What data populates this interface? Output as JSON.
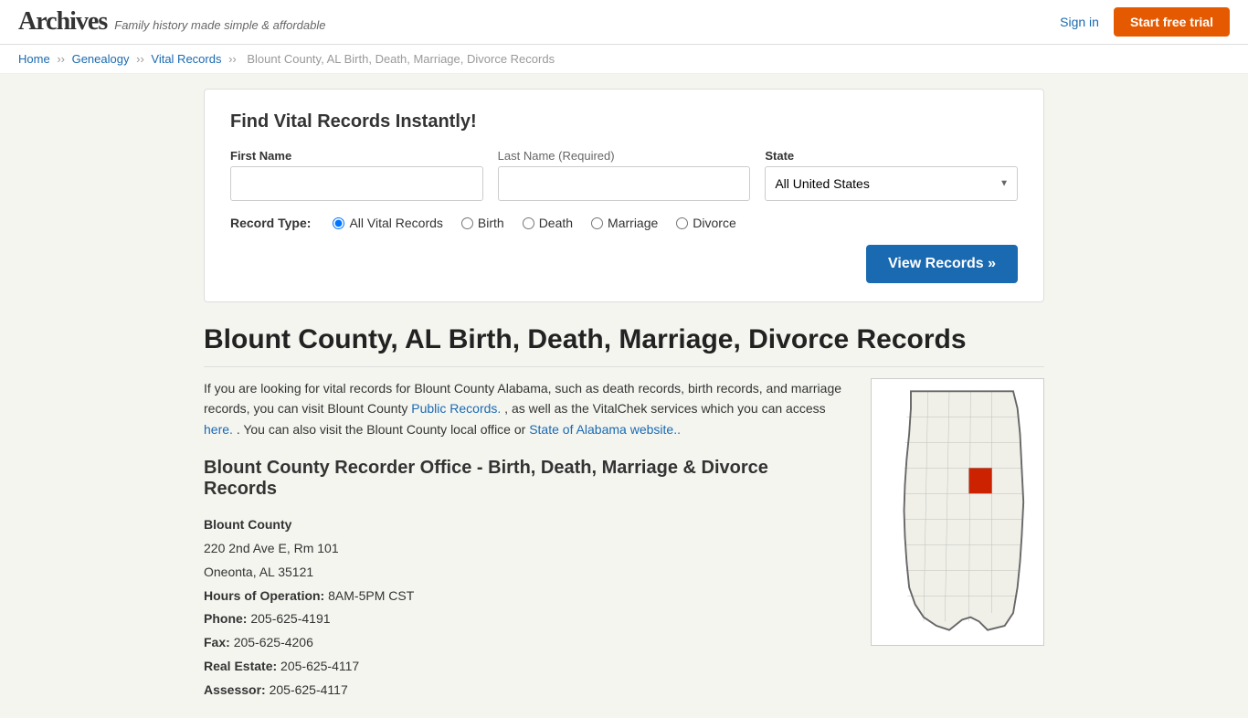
{
  "header": {
    "logo": "Archives",
    "tagline": "Family history made simple & affordable",
    "sign_in": "Sign in",
    "start_trial": "Start free trial"
  },
  "breadcrumb": {
    "home": "Home",
    "genealogy": "Genealogy",
    "vital_records": "Vital Records",
    "current": "Blount County, AL Birth, Death, Marriage, Divorce Records"
  },
  "search": {
    "title": "Find Vital Records Instantly!",
    "first_name_label": "First Name",
    "last_name_label": "Last Name",
    "last_name_required": "(Required)",
    "state_label": "State",
    "state_value": "All United States",
    "record_type_label": "Record Type:",
    "record_types": [
      {
        "id": "all",
        "label": "All Vital Records",
        "checked": true
      },
      {
        "id": "birth",
        "label": "Birth",
        "checked": false
      },
      {
        "id": "death",
        "label": "Death",
        "checked": false
      },
      {
        "id": "marriage",
        "label": "Marriage",
        "checked": false
      },
      {
        "id": "divorce",
        "label": "Divorce",
        "checked": false
      }
    ],
    "view_records_btn": "View Records »"
  },
  "page": {
    "heading": "Blount County, AL Birth, Death, Marriage, Divorce Records",
    "intro": "If you are looking for vital records for Blount County Alabama, such as death records, birth records, and marriage records, you can visit Blount County ",
    "public_records_link": "Public Records.",
    "intro_middle": " , as well as the VitalChek services which you can access ",
    "here_link": "here.",
    "intro_end": ". You can also visit the Blount County local office or ",
    "state_link": "State of Alabama website..",
    "recorder_heading": "Blount County Recorder Office - Birth, Death, Marriage & Divorce Records",
    "office": {
      "name": "Blount County",
      "address1": "220 2nd Ave E, Rm 101",
      "address2": "Oneonta, AL 35121",
      "hours_label": "Hours of Operation:",
      "hours_value": "8AM-5PM CST",
      "phone_label": "Phone:",
      "phone_value": "205-625-4191",
      "fax_label": "Fax:",
      "fax_value": "205-625-4206",
      "realestate_label": "Real Estate:",
      "realestate_value": "205-625-4117",
      "assessor_label": "Assessor:",
      "assessor_value": "205-625-4117"
    }
  }
}
